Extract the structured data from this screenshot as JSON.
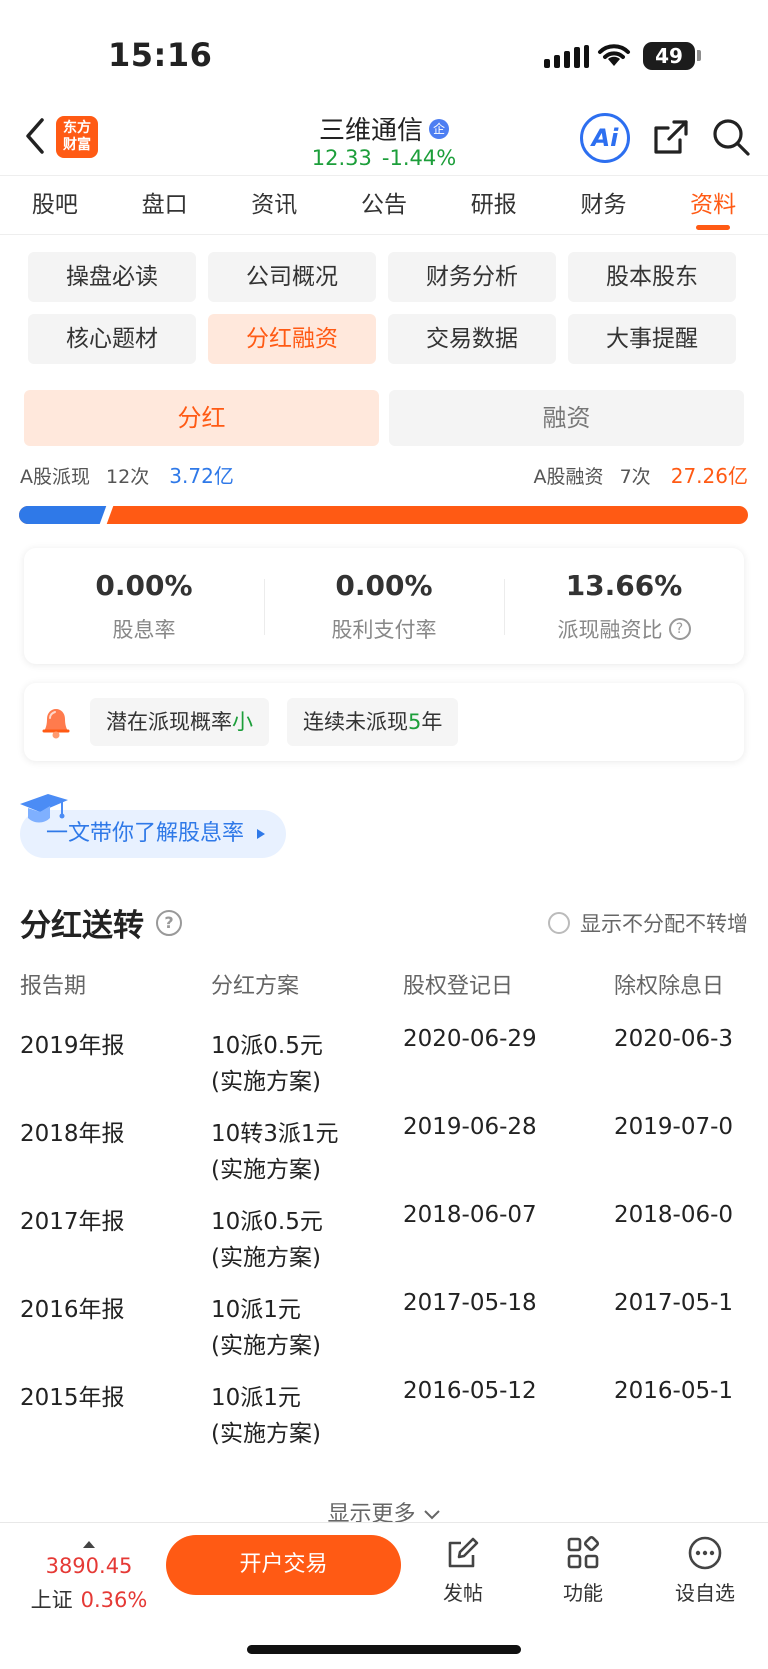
{
  "status_bar": {
    "time": "15:16",
    "battery": "49"
  },
  "header": {
    "stock_name": "三维通信",
    "badge": "企",
    "price": "12.33",
    "change": "-1.44%",
    "logo_line1": "东方",
    "logo_line2": "财富",
    "ai_label": "Ai"
  },
  "main_tabs": [
    "股吧",
    "盘口",
    "资讯",
    "公告",
    "研报",
    "财务",
    "资料"
  ],
  "sub_tabs": [
    "操盘必读",
    "公司概况",
    "财务分析",
    "股本股东",
    "核心题材",
    "分红融资",
    "交易数据",
    "大事提醒"
  ],
  "segment": {
    "dividend": "分红",
    "financing": "融资"
  },
  "summary": {
    "a_dividend_label": "A股派现",
    "a_dividend_count": "12次",
    "a_dividend_amount": "3.72亿",
    "a_financing_label": "A股融资",
    "a_financing_count": "7次",
    "a_financing_amount": "27.26亿",
    "dividend_share": 0.12
  },
  "metrics": [
    {
      "value": "0.00%",
      "label": "股息率"
    },
    {
      "value": "0.00%",
      "label": "股利支付率"
    },
    {
      "value": "13.66%",
      "label": "派现融资比"
    }
  ],
  "tags": {
    "potential_prefix": "潜在派现概率",
    "potential_value": "小",
    "streak_prefix": "连续未派现",
    "streak_value": "5",
    "streak_suffix": "年"
  },
  "learn_link": "一文带你了解股息率",
  "section": {
    "title": "分红送转",
    "toggle_label": "显示不分配不转增"
  },
  "table": {
    "headers": [
      "报告期",
      "分红方案",
      "股权登记日",
      "除权除息日"
    ],
    "rows": [
      {
        "period": "2019年报",
        "plan": "10派0.5元",
        "plan_status": "(实施方案)",
        "record_date": "2020-06-29",
        "ex_date": "2020-06-3"
      },
      {
        "period": "2018年报",
        "plan": "10转3派1元",
        "plan_status": "(实施方案)",
        "record_date": "2019-06-28",
        "ex_date": "2019-07-0"
      },
      {
        "period": "2017年报",
        "plan": "10派0.5元",
        "plan_status": "(实施方案)",
        "record_date": "2018-06-07",
        "ex_date": "2018-06-0"
      },
      {
        "period": "2016年报",
        "plan": "10派1元",
        "plan_status": "(实施方案)",
        "record_date": "2017-05-18",
        "ex_date": "2017-05-1"
      },
      {
        "period": "2015年报",
        "plan": "10派1元",
        "plan_status": "(实施方案)",
        "record_date": "2016-05-12",
        "ex_date": "2016-05-1"
      }
    ]
  },
  "show_more": "显示更多",
  "bottom_bar": {
    "index_value": "3890.45",
    "index_name": "上证",
    "index_change": "0.36%",
    "trade_button": "开户交易",
    "post_label": "发帖",
    "function_label": "功能",
    "watchlist_label": "设自选"
  },
  "colors": {
    "accent": "#ff5a14",
    "up_green": "#1c9e3a",
    "blue": "#2f79e8",
    "down_red": "#e53935"
  }
}
